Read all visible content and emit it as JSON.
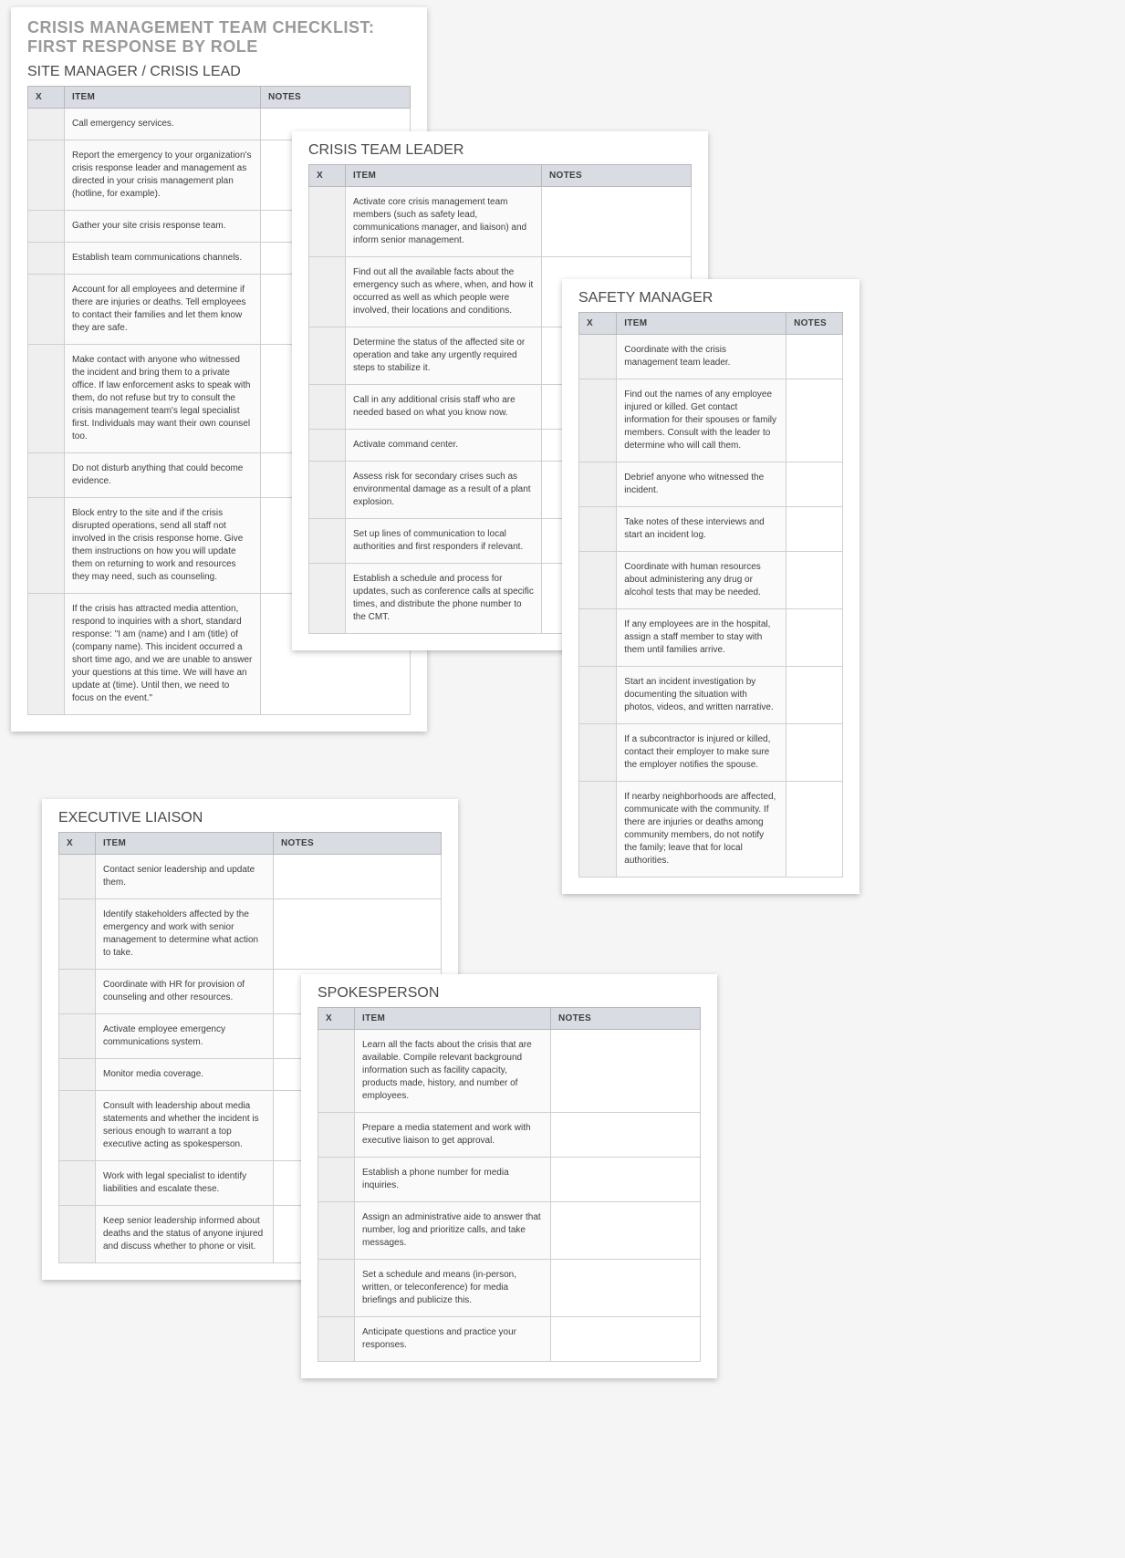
{
  "title": "CRISIS MANAGEMENT TEAM CHECKLIST:  FIRST RESPONSE BY ROLE",
  "columns": {
    "x": "X",
    "item": "ITEM",
    "notes": "NOTES"
  },
  "sections": {
    "site_manager": {
      "heading": "SITE MANAGER / CRISIS LEAD",
      "items": [
        "Call emergency services.",
        "Report the emergency to your organization's crisis response leader and management as directed in your crisis management plan (hotline, for example).",
        "Gather your site crisis response team.",
        "Establish team communications channels.",
        "Account for all employees and determine if there are injuries or deaths. Tell employees to contact their families and let them know they are safe.",
        "Make contact with anyone who witnessed the incident and bring them to a private office. If law enforcement asks to speak with them, do not refuse but try to consult the crisis management team's legal specialist first. Individuals may want their own counsel too.",
        "Do not disturb anything that could become evidence.",
        "Block entry to the site and if the crisis disrupted operations, send all staff not involved in the crisis response home. Give them instructions on how you will update them on returning to work and resources they may need, such as counseling.",
        "If the crisis has attracted media attention, respond to inquiries with a short, standard response: \"I am (name) and I am (title) of (company name). This incident occurred a short time ago, and we are unable to answer your questions at this time. We will have an update at (time). Until then, we need to focus on the event.\""
      ]
    },
    "crisis_team_leader": {
      "heading": "CRISIS TEAM LEADER",
      "items": [
        "Activate core crisis management team members (such as safety lead, communications manager, and liaison) and inform senior management.",
        "Find out all the available facts about the emergency such as where, when, and how it occurred as well as which people were involved, their locations and conditions.",
        "Determine the status of the affected site or operation and take any urgently required steps to stabilize it.",
        "Call in any additional crisis staff who are needed based on what you know now.",
        "Activate command center.",
        "Assess risk for secondary crises such as environmental damage as a result of a plant explosion.",
        "Set up lines of communication to local authorities and first responders if relevant.",
        "Establish a schedule and process for updates, such as conference calls at specific times, and distribute the phone number to the CMT."
      ]
    },
    "safety_manager": {
      "heading": "SAFETY MANAGER",
      "items": [
        "Coordinate with the crisis management team leader.",
        "Find out the names of any employee injured or killed. Get contact information for their spouses or family members. Consult with the leader to determine who will call them.",
        "Debrief anyone who witnessed the incident.",
        "Take notes of these interviews and start an incident log.",
        "Coordinate with human resources about administering any drug or alcohol tests that may be needed.",
        "If any employees are in the hospital, assign a staff member to stay with them until families arrive.",
        "Start an incident investigation by documenting the situation with photos, videos, and written narrative.",
        "If a subcontractor is injured or killed, contact their employer to make sure the employer notifies the spouse.",
        "If nearby neighborhoods are affected, communicate with the community. If there are injuries or deaths among community members, do not notify the family; leave that for local authorities."
      ]
    },
    "executive_liaison": {
      "heading": "EXECUTIVE LIAISON",
      "items": [
        "Contact senior leadership and update them.",
        "Identify stakeholders affected by the emergency and work with senior management to determine what action to take.",
        "Coordinate with HR for provision of counseling and other resources.",
        "Activate employee emergency communications system.",
        "Monitor media coverage.",
        "Consult with leadership about media statements and  whether the incident is serious enough to warrant a top executive acting as spokesperson.",
        "Work with legal specialist to identify liabilities and escalate these.",
        "Keep senior leadership informed about deaths and the status of anyone injured and discuss whether to phone or visit."
      ]
    },
    "spokesperson": {
      "heading": "SPOKESPERSON",
      "items": [
        "Learn all the facts about the crisis that are available. Compile relevant background information such as facility capacity, products made, history, and number of employees.",
        "Prepare a media statement and work with executive liaison to get approval.",
        "Establish a phone number for media inquiries.",
        "Assign an administrative aide to answer that number, log and prioritize calls, and take messages.",
        "Set a schedule and means (in-person, written, or teleconference) for media briefings and publicize this.",
        "Anticipate questions and practice your responses."
      ]
    }
  }
}
